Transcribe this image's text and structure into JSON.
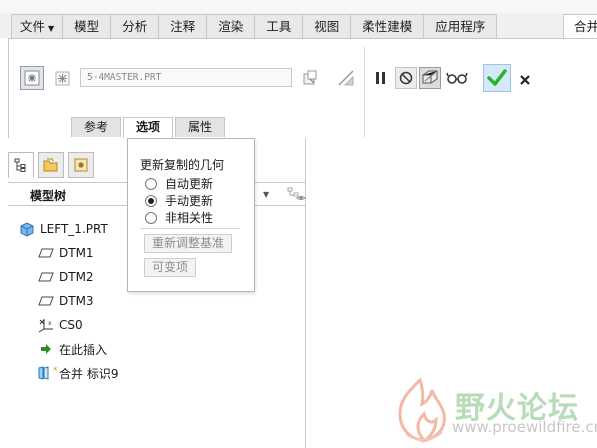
{
  "menu": {
    "file_label": "文件",
    "tabs": [
      "模型",
      "分析",
      "注释",
      "渲染",
      "工具",
      "视图",
      "柔性建模",
      "应用程序"
    ],
    "active_tab": "合并"
  },
  "dashboard": {
    "reference_model": "5-4MASTER.PRT",
    "subtabs": {
      "reference": "参考",
      "options": "选项",
      "properties": "属性"
    }
  },
  "model_tree": {
    "title": "模型树",
    "items": [
      {
        "label": "LEFT_1.PRT",
        "icon": "part-icon"
      },
      {
        "label": "DTM1",
        "icon": "datum-plane-icon"
      },
      {
        "label": "DTM2",
        "icon": "datum-plane-icon"
      },
      {
        "label": "DTM3",
        "icon": "datum-plane-icon"
      },
      {
        "label": "CS0",
        "icon": "coordinate-system-icon"
      },
      {
        "label": "在此插入",
        "icon": "insert-here-arrow-icon"
      },
      {
        "label": "合并 标识9",
        "icon": "merge-feature-icon"
      }
    ]
  },
  "options_popup": {
    "title": "更新复制的几何",
    "radio_options": [
      {
        "label": "自动更新",
        "selected": false
      },
      {
        "label": "手动更新",
        "selected": true
      },
      {
        "label": "非相关性",
        "selected": false
      }
    ],
    "rescale_button": "重新调整基准",
    "variable_button": "可变项"
  },
  "watermark": {
    "text": "野火论坛",
    "url": "www.proewildfire.cn"
  },
  "colors": {
    "ok_button": "#2bb32b",
    "part_icon": "#3a8fd6",
    "insert_arrow": "#2e8b22",
    "watermark_green": "#b6dcb8"
  }
}
